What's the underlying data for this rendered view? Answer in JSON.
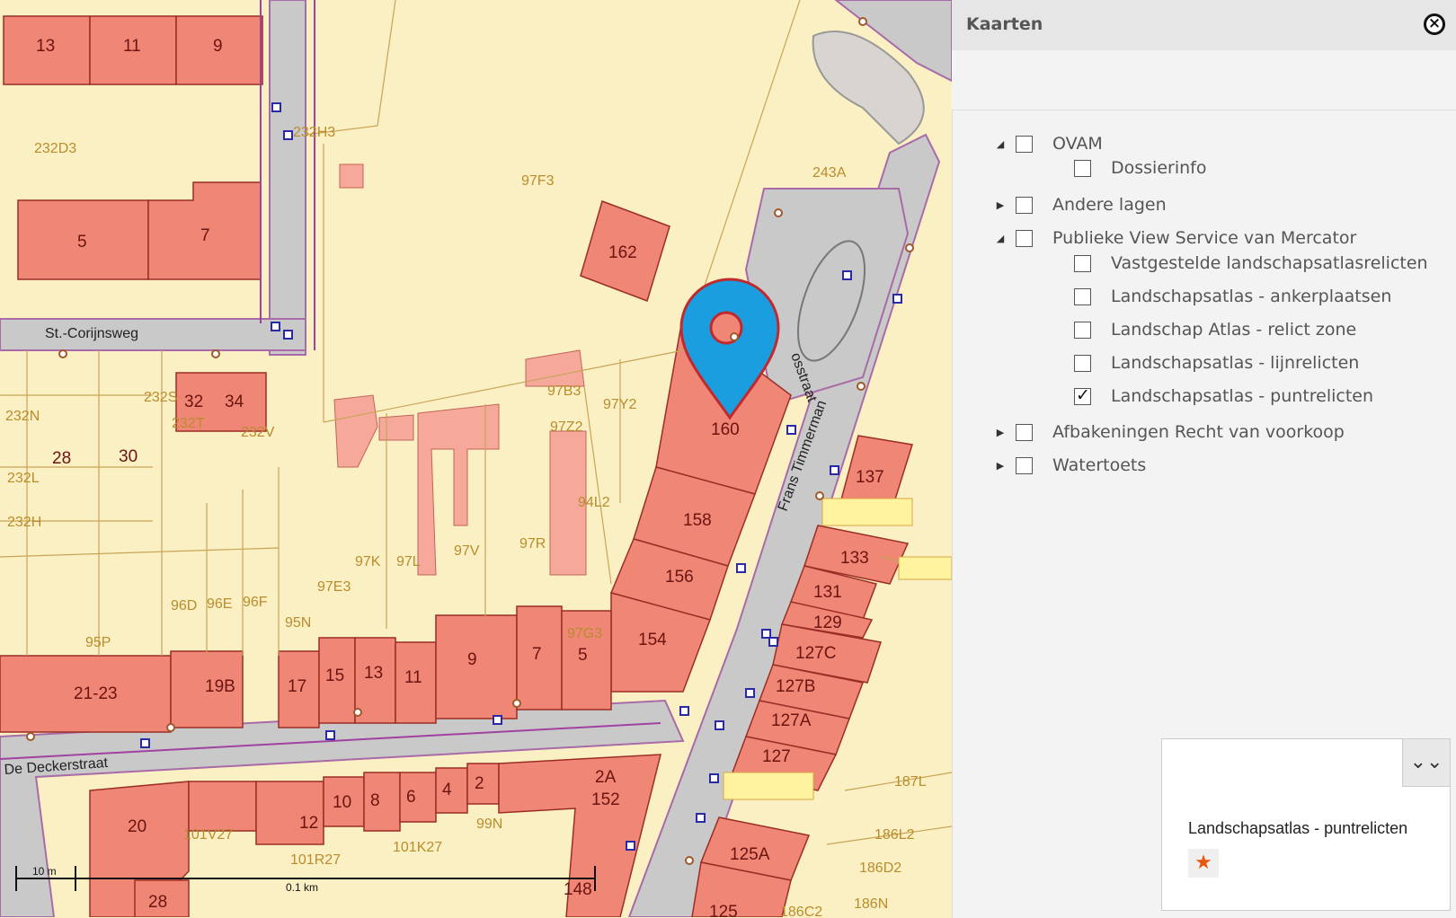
{
  "panel": {
    "title": "Kaarten",
    "close_icon": "close-circle-icon"
  },
  "layers": [
    {
      "label": "OVAM",
      "level": 0,
      "expanded": true,
      "checked": false
    },
    {
      "label": "Dossierinfo",
      "level": 1,
      "checked": false
    },
    {
      "label": "Andere lagen",
      "level": 0,
      "expanded": false,
      "checked": false
    },
    {
      "label": "Publieke View Service van Mercator",
      "level": 0,
      "expanded": true,
      "checked": false
    },
    {
      "label": "Vastgestelde landschapsatlasrelicten",
      "level": 1,
      "checked": false
    },
    {
      "label": "Landschapsatlas - ankerplaatsen",
      "level": 1,
      "checked": false
    },
    {
      "label": "Landschap Atlas - relict zone",
      "level": 1,
      "checked": false
    },
    {
      "label": "Landschapsatlas - lijnrelicten",
      "level": 1,
      "checked": false
    },
    {
      "label": "Landschapsatlas - puntrelicten",
      "level": 1,
      "checked": true
    },
    {
      "label": "Afbakeningen Recht van voorkoop",
      "level": 0,
      "expanded": false,
      "checked": false
    },
    {
      "label": "Watertoets",
      "level": 0,
      "expanded": false,
      "checked": false
    }
  ],
  "legend": {
    "title": "Landschapsatlas - puntrelicten",
    "toggle_icon": "double-chevron-down-icon",
    "symbol_icon": "star-icon",
    "symbol_color": "#e8560a"
  },
  "map": {
    "streets": {
      "corijnsweg": "St.-Corijnsweg",
      "deckerstraat": "De Deckerstraat",
      "timmermans": "Frans Timmerman",
      "vosstraat": "osstraat"
    },
    "buildings": {
      "b13": "13",
      "b11": "11",
      "b9": "9",
      "b5": "5",
      "b7": "7",
      "b162": "162",
      "b32": "32",
      "b34": "34",
      "b28": "28",
      "b30": "30",
      "b160": "160",
      "b158": "158",
      "b156": "156",
      "b154": "154",
      "b137": "137",
      "b133": "133",
      "b131": "131",
      "b129": "129",
      "b127c": "127C",
      "b127b": "127B",
      "b127a": "127A",
      "b127": "127",
      "b125a": "125A",
      "b125": "125",
      "b2123": "21-23",
      "b19b": "19B",
      "b17": "17",
      "b15": "15",
      "b13b": "13",
      "b11b": "11",
      "b9b": "9",
      "b7b": "7",
      "b5b": "5",
      "b20": "20",
      "b12": "12",
      "b10": "10",
      "b8": "8",
      "b6": "6",
      "b4": "4",
      "b2": "2",
      "b2a": "2A",
      "b152": "152",
      "b148": "148",
      "b28b": "28"
    },
    "parcels": {
      "p232d3": "232D3",
      "p232h3": "232H3",
      "p97f3": "97F3",
      "p243a": "243A",
      "p232n": "232N",
      "p232s": "232S",
      "p232t": "232T",
      "p232v": "232V",
      "p232l": "232L",
      "p232h": "232H",
      "p97b3": "97B3",
      "p97y2": "97Y2",
      "p97z2": "97Z2",
      "p94l2": "94L2",
      "p97v": "97V",
      "p97r": "97R",
      "p97k": "97K",
      "p97l": "97L",
      "p97e3": "97E3",
      "p96d": "96D",
      "p96e": "96E",
      "p96f": "96F",
      "p95n": "95N",
      "p95p": "95P",
      "p97g3": "97G3",
      "p99n": "99N",
      "p101v27": "101V27",
      "p101r27": "101R27",
      "p101k27": "101K27",
      "p187l": "187L",
      "p186l2": "186L2",
      "p186d2": "186D2",
      "p186n": "186N",
      "p186c2": "186C2"
    },
    "marker_icon": "map-pin-icon",
    "scale": {
      "label_left": "10 m",
      "label_right": "0.1 km"
    }
  }
}
